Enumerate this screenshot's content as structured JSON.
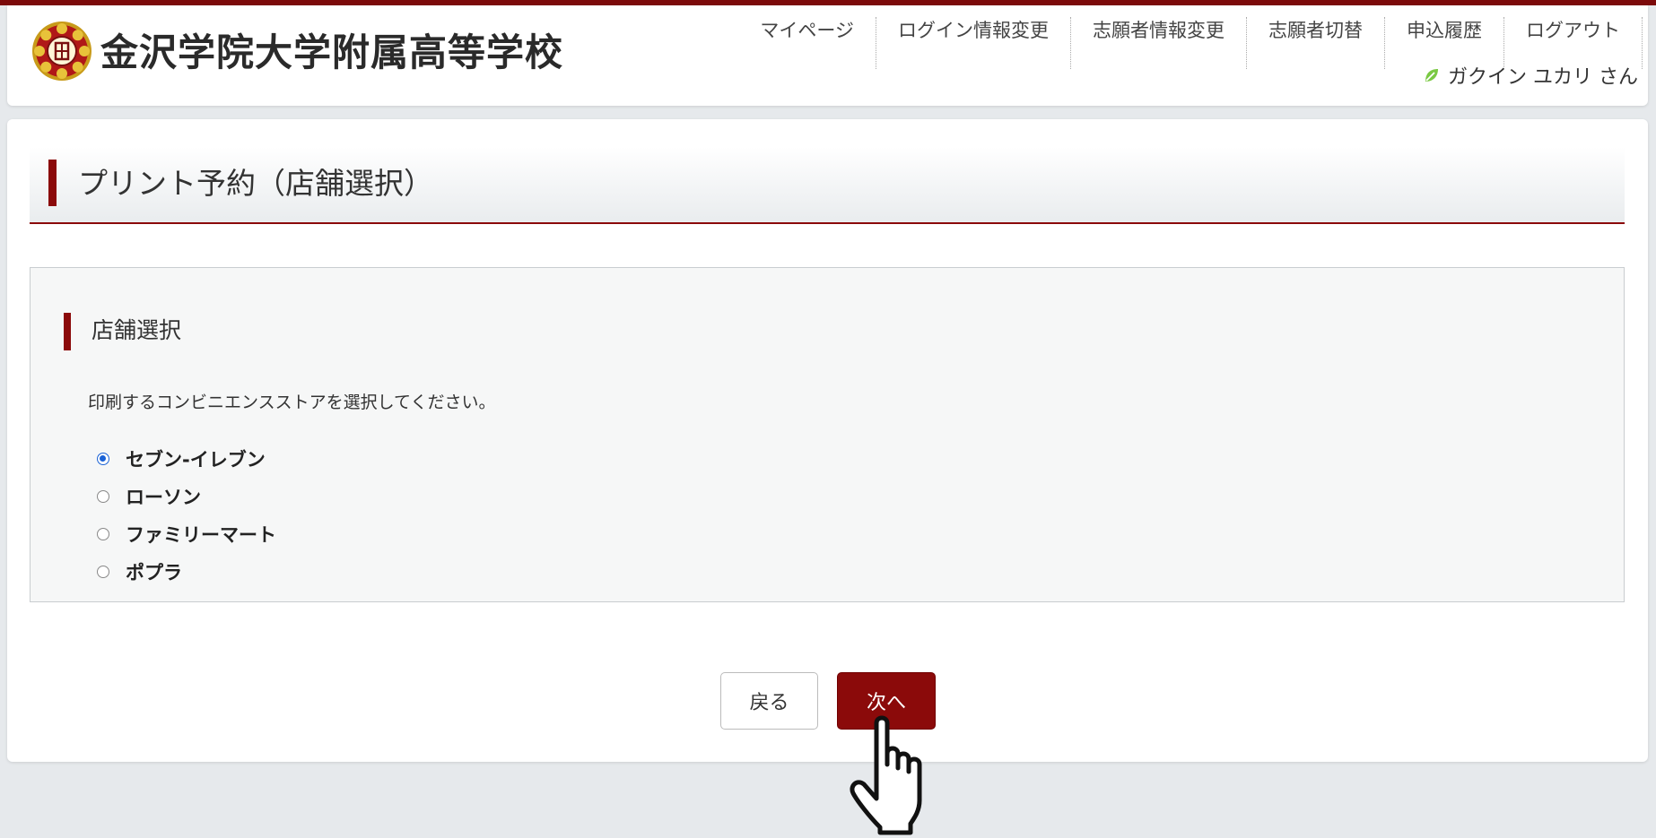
{
  "header": {
    "school_name": "金沢学院大学附属高等学校",
    "nav": [
      "マイページ",
      "ログイン情報変更",
      "志願者情報変更",
      "志願者切替",
      "申込履歴",
      "ログアウト"
    ],
    "user_name": "ガクイン ユカリ さん"
  },
  "page": {
    "title": "プリント予約（店舗選択）"
  },
  "panel": {
    "title": "店舗選択",
    "instruction": "印刷するコンビニエンスストアを選択してください。",
    "options": [
      {
        "label": "セブン-イレブン",
        "selected": true
      },
      {
        "label": "ローソン",
        "selected": false
      },
      {
        "label": "ファミリーマート",
        "selected": false
      },
      {
        "label": "ポプラ",
        "selected": false
      }
    ]
  },
  "buttons": {
    "back": "戻る",
    "next": "次へ"
  },
  "colors": {
    "accent": "#8b0a0a",
    "radio_selected": "#1a62d6",
    "user_icon": "#7ac943"
  },
  "icons": {
    "logo": "school-emblem-icon",
    "user": "leaf-icon",
    "cursor": "hand-pointer-icon"
  }
}
